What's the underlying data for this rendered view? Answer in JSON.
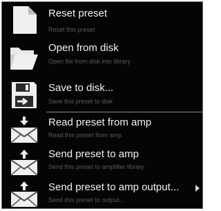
{
  "menu": {
    "items": [
      {
        "label": "Reset preset",
        "description": "Reset this preset",
        "icon": "new-document-icon"
      },
      {
        "label": "Open from disk",
        "description": "Open file from disk into library",
        "icon": "open-folder-icon"
      },
      {
        "label": "Save to disk...",
        "description": "Save this preset to disk",
        "icon": "save-disk-icon"
      },
      {
        "label": "Read preset from amp",
        "description": "Read this preset from amp",
        "icon": "envelope-download-icon"
      },
      {
        "label": "Send preset to amp",
        "description": "Send this preset to amplifier library",
        "icon": "envelope-upload-icon"
      },
      {
        "label": "Send preset to amp output...",
        "description": "Send this preset to output...",
        "icon": "envelope-upload-icon"
      }
    ]
  },
  "colors": {
    "background": "#050505",
    "text": "#f2f2f2",
    "description": "#5a5a5a",
    "separator": "#8a8a8a"
  }
}
